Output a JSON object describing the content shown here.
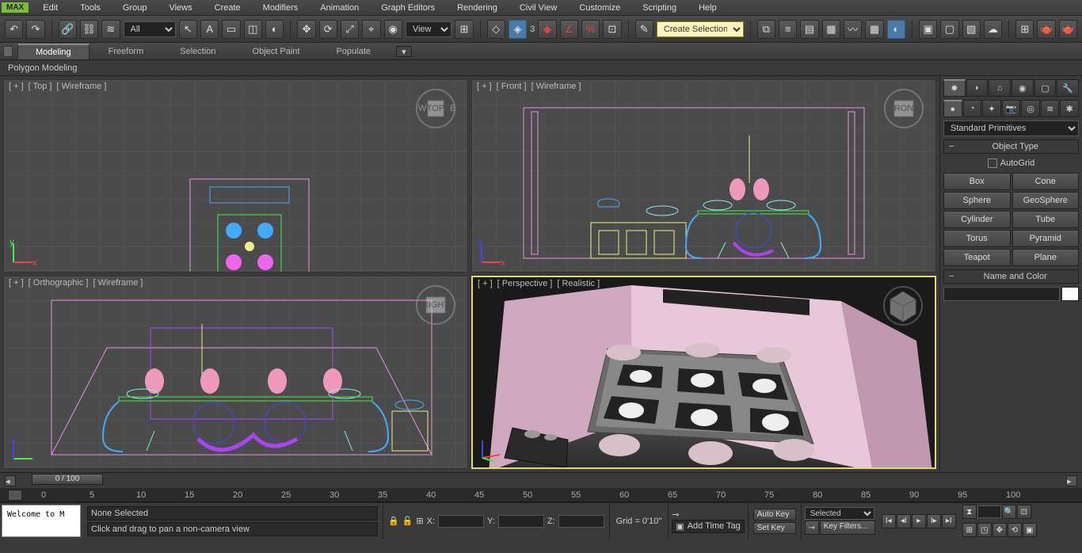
{
  "app_badge": "MAX",
  "menu": [
    "Edit",
    "Tools",
    "Group",
    "Views",
    "Create",
    "Modifiers",
    "Animation",
    "Graph Editors",
    "Rendering",
    "Civil View",
    "Customize",
    "Scripting",
    "Help"
  ],
  "toolbar": {
    "filter_all": "All",
    "ref_coord": "View",
    "spinner_value": "3",
    "named_sel": "Create Selection Se"
  },
  "ribbon": {
    "tabs": [
      "Modeling",
      "Freeform",
      "Selection",
      "Object Paint",
      "Populate"
    ],
    "sub": "Polygon Modeling"
  },
  "viewports": {
    "tl": {
      "plus": "[ + ]",
      "view": "[ Top ]",
      "shade": "[ Wireframe ]",
      "cube": "TOP"
    },
    "tr": {
      "plus": "[ + ]",
      "view": "[ Front ]",
      "shade": "[ Wireframe ]",
      "cube": "FRONT"
    },
    "bl": {
      "plus": "[ + ]",
      "view": "[ Orthographic ]",
      "shade": "[ Wireframe ]",
      "cube": "RIGHT"
    },
    "br": {
      "plus": "[ + ]",
      "view": "[ Perspective ]",
      "shade": "[ Realistic ]"
    }
  },
  "cmdpanel": {
    "dropdown": "Standard Primitives",
    "object_type_head": "Object Type",
    "autogrid": "AutoGrid",
    "primitives": [
      "Box",
      "Cone",
      "Sphere",
      "GeoSphere",
      "Cylinder",
      "Tube",
      "Torus",
      "Pyramid",
      "Teapot",
      "Plane"
    ],
    "name_head": "Name and Color"
  },
  "timeslider": {
    "label": "0 / 100"
  },
  "track_ticks": [
    "0",
    "5",
    "10",
    "15",
    "20",
    "25",
    "30",
    "35",
    "40",
    "45",
    "50",
    "55",
    "60",
    "65",
    "70",
    "75",
    "80",
    "85",
    "90",
    "95",
    "100"
  ],
  "status": {
    "welcome": "Welcome to M",
    "selection": "None Selected",
    "hint": "Click and drag to pan a non-camera view",
    "x": "X:",
    "y": "Y:",
    "z": "Z:",
    "grid": "Grid = 0'10\"",
    "autokey": "Auto Key",
    "setkey": "Set Key",
    "sel_filter": "Selected",
    "keyfilters": "Key Filters...",
    "time_tag": "Add Time Tag"
  },
  "icons": {
    "undo": "↶",
    "redo": "↷",
    "link": "🔗",
    "unlink": "⛓",
    "bind": "≋",
    "cursor": "↖",
    "name": "A",
    "rect": "▭",
    "win": "◫",
    "circ": "◐",
    "move": "✥",
    "rotate": "⟳",
    "scale": "⤢",
    "refcoord": "⌖",
    "pivot": "◉",
    "manip": "⊞",
    "snap": "◇",
    "snap2": "◈",
    "snap3": "◆",
    "ang": "∠",
    "pct": "%",
    "spn": "⊡",
    "mirror": "⧉",
    "align": "≡",
    "layers": "▤",
    "schematic": "▦",
    "mat": "◐",
    "render": "▣",
    "rframe": "▢",
    "curve": "〰",
    "rendlast": "▶",
    "teapot": "🫖"
  }
}
